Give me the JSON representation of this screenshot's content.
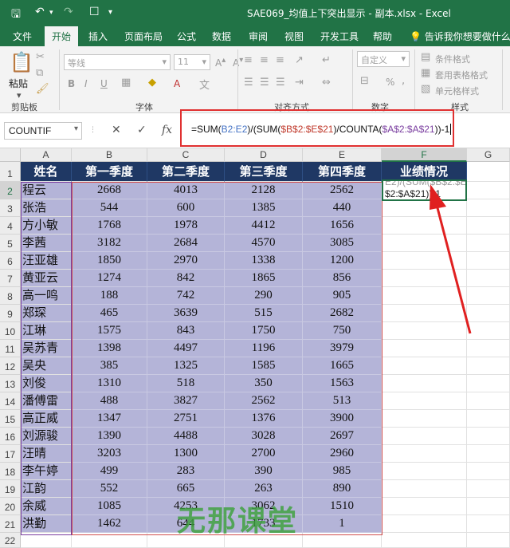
{
  "window": {
    "title": "SAE069_均值上下突出显示 - 副本.xlsx  -  Excel",
    "quick_access": [
      "save-icon",
      "undo-icon",
      "redo-icon",
      "new-doc-icon"
    ]
  },
  "ribbon_tabs": [
    "文件",
    "开始",
    "插入",
    "页面布局",
    "公式",
    "数据",
    "审阅",
    "视图",
    "开发工具",
    "帮助"
  ],
  "active_tab": "开始",
  "tell_me": "告诉我你想要做什么",
  "ribbon": {
    "clipboard": {
      "label": "剪贴板",
      "paste": "粘贴"
    },
    "font": {
      "label": "字体",
      "font_name": "等线",
      "font_size": "11",
      "bold": "B",
      "italic": "I",
      "underline": "U"
    },
    "alignment": {
      "label": "对齐方式"
    },
    "number": {
      "label": "数字",
      "format": "自定义",
      "percent": "%"
    },
    "styles": {
      "label": "样式",
      "items": [
        "条件格式",
        "套用表格格式",
        "单元格样式"
      ]
    }
  },
  "formula_bar": {
    "name_box": "COUNTIF",
    "cancel": "✕",
    "enter": "✓",
    "fx": "fx",
    "formula_parts": [
      {
        "text": "=SUM(",
        "color": "default"
      },
      {
        "text": "B2:E2",
        "color": "blue"
      },
      {
        "text": ")/(SUM(",
        "color": "default"
      },
      {
        "text": "$B$2:$E$21",
        "color": "red"
      },
      {
        "text": ")/COUNTA(",
        "color": "default"
      },
      {
        "text": "$A$2:$A$21",
        "color": "purple"
      },
      {
        "text": "))-1",
        "color": "default"
      }
    ]
  },
  "columns": [
    "A",
    "B",
    "C",
    "D",
    "E",
    "F",
    "G"
  ],
  "rows": [
    "1",
    "2",
    "3",
    "4",
    "5",
    "6",
    "7",
    "8",
    "9",
    "10",
    "11",
    "12",
    "13",
    "14",
    "15",
    "16",
    "17",
    "18",
    "19",
    "20",
    "21",
    "22"
  ],
  "table": {
    "headers": [
      "姓名",
      "第一季度",
      "第二季度",
      "第三季度",
      "第四季度",
      "业绩情况"
    ],
    "rows": [
      [
        "程云",
        "2668",
        "4013",
        "2128",
        "2562"
      ],
      [
        "张浩",
        "544",
        "600",
        "1385",
        "440"
      ],
      [
        "方小敏",
        "1768",
        "1978",
        "4412",
        "1656"
      ],
      [
        "李茜",
        "3182",
        "2684",
        "4570",
        "3085"
      ],
      [
        "汪亚雄",
        "1850",
        "2970",
        "1338",
        "1200"
      ],
      [
        "黄亚云",
        "1274",
        "842",
        "1865",
        "856"
      ],
      [
        "高一鸣",
        "188",
        "742",
        "290",
        "905"
      ],
      [
        "郑琛",
        "465",
        "3639",
        "515",
        "2682"
      ],
      [
        "江琳",
        "1575",
        "843",
        "1750",
        "750"
      ],
      [
        "吴苏青",
        "1398",
        "4497",
        "1196",
        "3979"
      ],
      [
        "吴央",
        "385",
        "1325",
        "1585",
        "1665"
      ],
      [
        "刘俊",
        "1310",
        "518",
        "350",
        "1563"
      ],
      [
        "潘傅雷",
        "488",
        "3827",
        "2562",
        "513"
      ],
      [
        "高正威",
        "1347",
        "2751",
        "1376",
        "3900"
      ],
      [
        "刘源骏",
        "1390",
        "4488",
        "3028",
        "2697"
      ],
      [
        "汪晴",
        "3203",
        "1300",
        "2700",
        "2960"
      ],
      [
        "李午婷",
        "499",
        "283",
        "390",
        "985"
      ],
      [
        "江韵",
        "552",
        "665",
        "263",
        "890"
      ],
      [
        "余威",
        "1085",
        "4253",
        "3062",
        "1510"
      ],
      [
        "洪勤",
        "1462",
        "644",
        "1733",
        "1"
      ]
    ]
  },
  "edit_cell": {
    "line1": "E2)/(SUM($B$2:$E$21)/COUNTA($A",
    "line2": "$2:$A$21))-1"
  },
  "watermark": "无那课堂",
  "colors": {
    "excel_green": "#217346",
    "header_navy": "#1f3864",
    "selection_fill": "#b4b4d8",
    "annotation_red": "#e03030"
  }
}
